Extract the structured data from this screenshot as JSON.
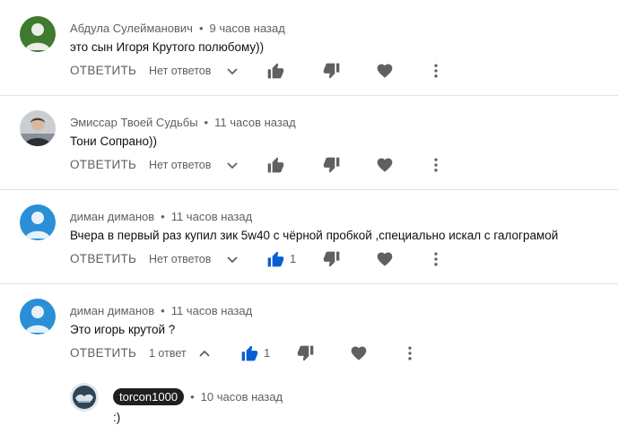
{
  "comments": [
    {
      "author": "Абдула Сулейманович",
      "time": "9 часов назад",
      "text": "это сын Игоря Крутого полюбому))",
      "reply_label": "ОТВЕТИТЬ",
      "replies_label": "Нет ответов",
      "likes": "",
      "liked": false,
      "avatar_color": "#3f7a2e"
    },
    {
      "author": "Эмиссар Твоей Судьбы",
      "time": "11 часов назад",
      "text": "Тони Сопрано))",
      "reply_label": "ОТВЕТИТЬ",
      "replies_label": "Нет ответов",
      "likes": "",
      "liked": false,
      "avatar_color": "photo"
    },
    {
      "author": "диман диманов",
      "time": "11 часов назад",
      "text": "Вчера в первый раз купил зик 5w40 с чёрной пробкой ,специально искал с галограмой",
      "reply_label": "ОТВЕТИТЬ",
      "replies_label": "Нет ответов",
      "likes": "1",
      "liked": true,
      "avatar_color": "#2a8fd6"
    },
    {
      "author": "диман диманов",
      "time": "11 часов назад",
      "text": "Это игорь крутой ?",
      "reply_label": "ОТВЕТИТЬ",
      "replies_label": "1 ответ",
      "likes": "1",
      "liked": true,
      "avatar_color": "#2a8fd6"
    }
  ],
  "reply": {
    "author": "torcon1000",
    "time": "10 часов назад",
    "text": ":)"
  },
  "colors": {
    "accent": "#065fd4",
    "icon": "#606060"
  }
}
